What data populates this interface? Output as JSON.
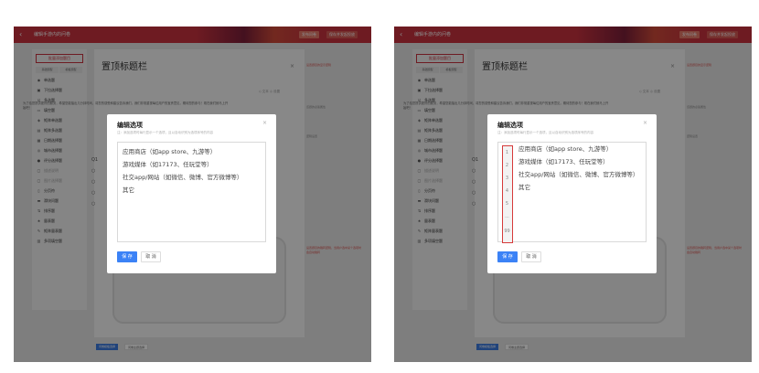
{
  "app": {
    "back_icon": "back-arrow-icon",
    "title": "编辑手游内的问卷",
    "buttons": [
      "发布问卷",
      "保存并发起投放"
    ]
  },
  "sidebar": {
    "add_label": "批量添加题目",
    "tabs": [
      "基础题型",
      "模板题型"
    ],
    "question_types": [
      {
        "icon": "radio-icon",
        "label": "单选题"
      },
      {
        "icon": "dropdown-icon",
        "label": "下拉选择题"
      },
      {
        "icon": "checkbox-icon",
        "label": "多选题"
      },
      {
        "icon": "fill-icon",
        "label": "填空题"
      },
      {
        "icon": "matrix-radio-icon",
        "label": "矩阵单选题"
      },
      {
        "icon": "matrix-checkbox-icon",
        "label": "矩阵多选题"
      },
      {
        "icon": "date-icon",
        "label": "日期选择题"
      },
      {
        "icon": "city-icon",
        "label": "城市选择题"
      },
      {
        "icon": "score-icon",
        "label": "评分选择题"
      },
      {
        "icon": "text-icon",
        "label": "描述说明",
        "disabled": true
      },
      {
        "icon": "image-icon",
        "label": "图片选择题",
        "disabled": true
      },
      {
        "icon": "page-icon",
        "label": "分页符"
      },
      {
        "icon": "slider-icon",
        "label": "滑块问题"
      },
      {
        "icon": "sort-icon",
        "label": "排序题"
      },
      {
        "icon": "star-icon",
        "label": "量表题"
      },
      {
        "icon": "nps-icon",
        "label": "矩阵量表题"
      },
      {
        "icon": "group-icon",
        "label": "多项填空题"
      }
    ]
  },
  "editor": {
    "title": "置顶标题栏",
    "tools": "◇ 文本    ◎ 设置",
    "intro": "为了给您提供更好的服务，希望您能抽出几分钟时间，将您的感受和建议告诉我们，我们非常重视每位用户的宝贵意见，期待您的参与！现在我们就马上开始吧！",
    "question_prefix": "Q1",
    "tabs": [
      "问卷模板选择",
      "问卷主题选择"
    ],
    "right_notes": [
      "设置题目的显示逻辑",
      "该题的必答属性",
      "逻辑设置",
      "设置题目的跳转逻辑，当用户选中某个选项时会自动跳转"
    ]
  },
  "modal": {
    "title": "编辑选项",
    "close_icon": "close-icon",
    "hint": "注：添加选项时每行显示一个选项，且以自动识别为选项序号的内容",
    "options": [
      "应用商店（如app store、九游等）",
      "游戏媒体（如17173、任玩堂等）",
      "社交app/网站（如微信、微博、官方微博等）",
      "其它"
    ],
    "line_numbers": [
      "1",
      "2",
      "3",
      "4",
      "5",
      "...",
      "99"
    ],
    "save_label": "保 存",
    "cancel_label": "取 消"
  }
}
